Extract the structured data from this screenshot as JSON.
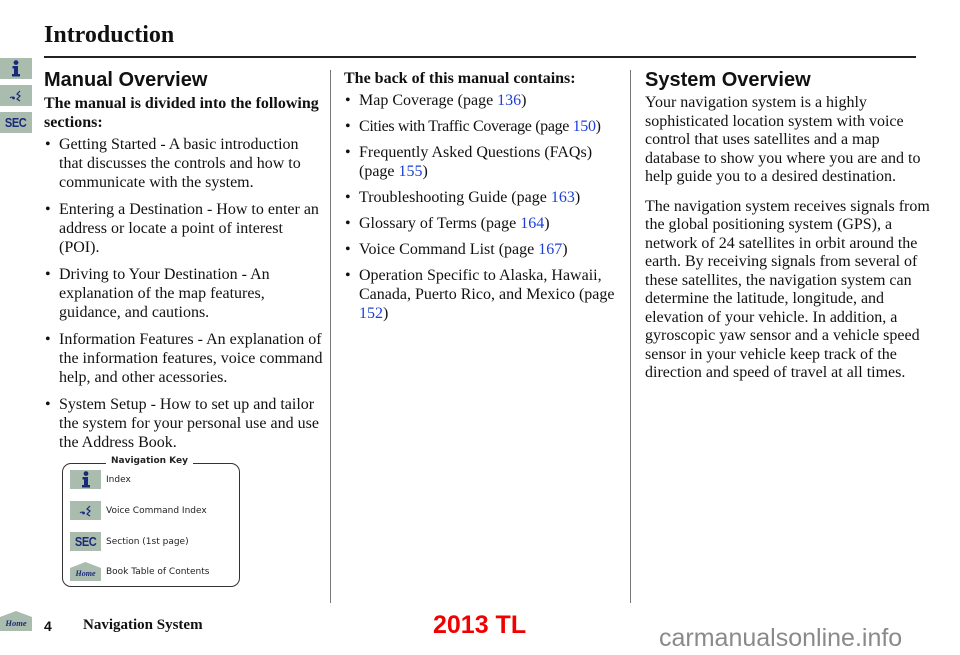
{
  "header": {
    "title": "Introduction"
  },
  "side_tabs": [
    {
      "icon": "info-icon",
      "label": ""
    },
    {
      "icon": "voice-command-icon",
      "label": ""
    },
    {
      "icon": "section-icon",
      "label": "SEC"
    }
  ],
  "home_tab": {
    "icon": "home-icon",
    "label": "Home"
  },
  "col1": {
    "heading": "Manual Overview",
    "lead": "The manual is divided into the following sections:",
    "items": [
      "Getting Started - A basic introduction that discusses the controls and how to communicate with the system.",
      "Entering a Destination - How to enter an address or locate a point of interest (POI).",
      "Driving to Your Destination - An explanation of the map features, guidance, and cautions.",
      "Information Features - An explanation of the information features, voice command help, and other acessories.",
      "System Setup - How to set up and tailor the system for your personal use and use the Address Book."
    ]
  },
  "nav_key": {
    "title": "Navigation Key",
    "items": [
      {
        "icon": "info-icon",
        "label": "Index"
      },
      {
        "icon": "voice-command-icon",
        "label": "Voice Command Index"
      },
      {
        "icon": "section-icon",
        "icon_text": "SEC",
        "label": "Section (1st page)"
      },
      {
        "icon": "home-icon",
        "icon_text": "Home",
        "label": "Book Table of Contents"
      }
    ]
  },
  "col2": {
    "lead": "The back of this manual contains:",
    "items": [
      {
        "text": "Map Coverage (page ",
        "page": "136",
        "after": ")"
      },
      {
        "text": "Cities with Traffic Coverage (page ",
        "page": "150",
        "after": ")"
      },
      {
        "text": "Frequently Asked Questions (FAQs) (page ",
        "page": "155",
        "after": ")"
      },
      {
        "text": "Troubleshooting Guide (page ",
        "page": "163",
        "after": ")"
      },
      {
        "text": "Glossary of Terms (page ",
        "page": "164",
        "after": ")"
      },
      {
        "text": "Voice Command List (page ",
        "page": "167",
        "after": ")"
      },
      {
        "text": "Operation Specific to Alaska, Hawaii, Canada, Puerto Rico, and Mexico (page ",
        "page": "152",
        "after": ")"
      }
    ]
  },
  "col3": {
    "heading": "System Overview",
    "paragraphs": [
      "Your navigation system is a highly sophisticated location system with voice control that uses satellites and a map database to show you where you are and to help guide you to a desired destination.",
      "The navigation system receives signals from the global positioning system (GPS), a network of 24 satellites in orbit around the earth. By receiving signals from several of these satellites, the navigation system can determine the latitude, longitude, and elevation of your vehicle. In addition, a gyroscopic yaw sensor and a vehicle speed sensor in your vehicle keep track of the direction and speed of travel at all times."
    ]
  },
  "footer": {
    "page_number": "4",
    "book_title": "Navigation System",
    "model": "2013 TL",
    "watermark": "carmanualsonline.info"
  },
  "colors": {
    "tab_bg": "#a9bcae",
    "icon_navy": "#1a2a7a",
    "link": "#1c3fd6",
    "model_red": "#f20000",
    "watermark_gray": "#8a8a8a"
  }
}
